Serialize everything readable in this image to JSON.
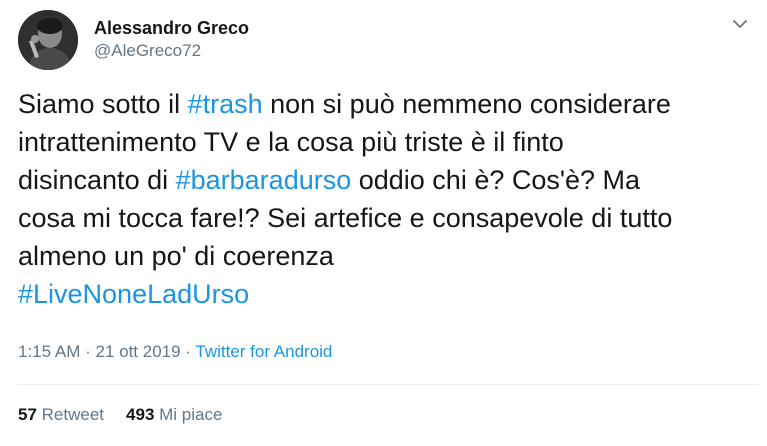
{
  "user": {
    "display_name": "Alessandro Greco",
    "handle": "@AleGreco72",
    "avatar_icon": "user-avatar-photo"
  },
  "menu": {
    "icon": "chevron-down-icon"
  },
  "tweet": {
    "line1_pre": "Siamo sotto il ",
    "hashtag1": "#trash",
    "line1_post": " non si può nemmeno considerare",
    "line2": "intrattenimento TV e la cosa più triste è il finto",
    "line3_pre": "disincanto di ",
    "hashtag2": "#barbaradurso",
    "line3_post": " oddio chi è? Cos'è? Ma",
    "line4": "cosa mi tocca fare!? Sei artefice e consapevole di tutto",
    "line5": "almeno un po' di coerenza",
    "hashtag3": "#LiveNoneLadUrso"
  },
  "meta": {
    "time": "1:15 AM",
    "separator1": " · ",
    "date": "21 ott 2019",
    "separator2": " · ",
    "source": "Twitter for Android"
  },
  "stats": {
    "retweet_count": "57",
    "retweet_label": "Retweet",
    "like_count": "493",
    "like_label": "Mi piace"
  },
  "colors": {
    "link": "#1b95e0",
    "text": "#14171a",
    "muted": "#657786",
    "divider": "#e6ecf0"
  }
}
